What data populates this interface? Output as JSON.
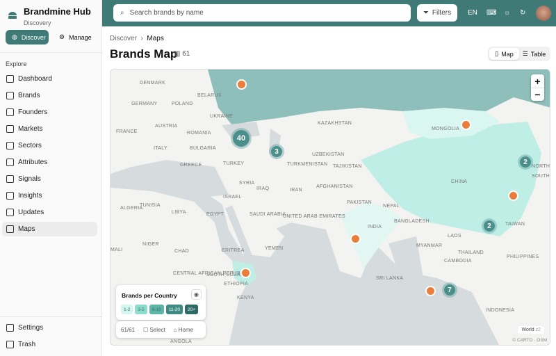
{
  "app": {
    "title": "Brandmine Hub",
    "subtitle": "Discovery"
  },
  "modes": [
    {
      "label": "Discover",
      "icon": "globe-icon",
      "active": true
    },
    {
      "label": "Manage",
      "icon": "gear-icon",
      "active": false
    }
  ],
  "sidebar": {
    "section": "Explore",
    "items": [
      {
        "label": "Dashboard",
        "icon": "grid-icon"
      },
      {
        "label": "Brands",
        "icon": "building-icon"
      },
      {
        "label": "Founders",
        "icon": "users-icon"
      },
      {
        "label": "Markets",
        "icon": "globe-icon"
      },
      {
        "label": "Sectors",
        "icon": "bar-chart-icon"
      },
      {
        "label": "Attributes",
        "icon": "tag-icon"
      },
      {
        "label": "Signals",
        "icon": "trend-icon"
      },
      {
        "label": "Insights",
        "icon": "lightbulb-icon"
      },
      {
        "label": "Updates",
        "icon": "newspaper-icon"
      },
      {
        "label": "Maps",
        "icon": "map-icon",
        "active": true
      }
    ],
    "bottom": [
      {
        "label": "Settings",
        "icon": "gear-icon"
      },
      {
        "label": "Trash",
        "icon": "trash-icon"
      }
    ]
  },
  "topbar": {
    "search_placeholder": "Search brands by name",
    "filters": "Filters",
    "lang": "EN"
  },
  "breadcrumb": [
    "Discover",
    "Maps"
  ],
  "page": {
    "title": "Brands Map",
    "count": "61"
  },
  "view_toggle": [
    {
      "label": "Map",
      "active": true
    },
    {
      "label": "Table",
      "active": false
    }
  ],
  "map": {
    "labels": [
      "DENMARK",
      "BELARUS",
      "POLAND",
      "UKRAINE",
      "GERMANY",
      "FRANCE",
      "AUSTRIA",
      "ROMANIA",
      "ITALY",
      "BULGARIA",
      "GREECE",
      "TURKEY",
      "KAZAKHSTAN",
      "MONGOLIA",
      "UZBEKISTAN",
      "TURKMENISTAN",
      "TAJIKISTAN",
      "SYRIA",
      "IRAQ",
      "IRAN",
      "AFGHANISTAN",
      "TUNISIA",
      "ISRAEL",
      "PAKISTAN",
      "CHINA",
      "NORTH KOREA",
      "SOUTH KOREA",
      "ALGERIA",
      "LIBYA",
      "EGYPT",
      "SAUDI ARABIA",
      "UNITED ARAB EMIRATES",
      "NEPAL",
      "BANGLADESH",
      "INDIA",
      "TAIWAN",
      "LAOS",
      "MALI",
      "NIGER",
      "CHAD",
      "ERITREA",
      "YEMEN",
      "MYANMAR",
      "THAILAND",
      "CAMBODIA",
      "PHILIPPINES",
      "CENTRAL AFRICAN REPUBLIC",
      "SOUTH SUDAN",
      "ETHIOPIA",
      "SRI LANKA",
      "KENYA",
      "INDONESIA",
      "ANGOLA"
    ],
    "clusters": [
      {
        "count": "40"
      },
      {
        "count": "3"
      },
      {
        "count": "2"
      },
      {
        "count": "2"
      },
      {
        "count": "7"
      }
    ],
    "singles": 6,
    "zoom_in": "+",
    "zoom_out": "−",
    "world_label": "World",
    "zoom_level": "z2",
    "attribution": "© CARTO · OSM",
    "colors": {
      "accent": "#3f7a77",
      "marker": "#ea7d3c",
      "russia": "#8fbfba",
      "china": "#bfeee6",
      "india": "#e2f7f2"
    }
  },
  "legend": {
    "title": "Brands per Country",
    "bins": [
      {
        "label": "1-2",
        "color": "#d5f5ef"
      },
      {
        "label": "3-5",
        "color": "#8fdccd"
      },
      {
        "label": "6-10",
        "color": "#5fb5a8"
      },
      {
        "label": "11-20",
        "color": "#3f8a82"
      },
      {
        "label": "20+",
        "color": "#2f6b66"
      }
    ],
    "selected": "61/61",
    "select": "Select",
    "home": "Home"
  }
}
